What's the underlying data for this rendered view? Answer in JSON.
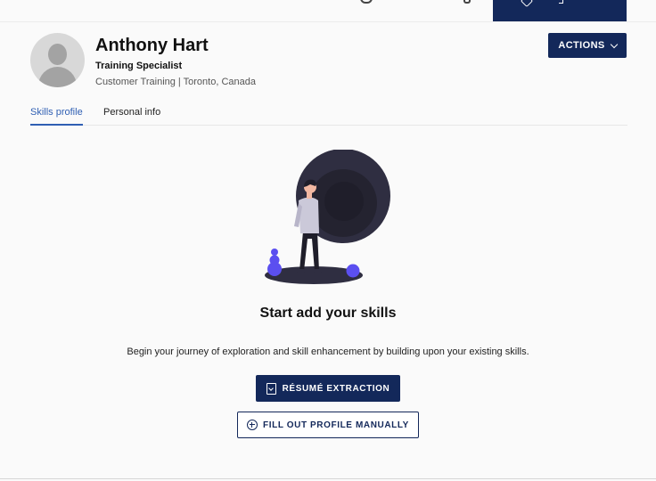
{
  "profile": {
    "name": "Anthony Hart",
    "title": "Training Specialist",
    "meta": "Customer Training | Toronto, Canada",
    "actions_label": "ACTIONS"
  },
  "tabs": [
    {
      "label": "Skills profile",
      "active": true
    },
    {
      "label": "Personal info",
      "active": false
    }
  ],
  "empty_state": {
    "heading": "Start add your skills",
    "description": "Begin your journey of exploration and skill enhancement by building upon your existing skills.",
    "primary_button": "RÉSUMÉ EXTRACTION",
    "secondary_button": "FILL OUT PROFILE MANUALLY"
  },
  "colors": {
    "brand_navy": "#13285a",
    "tab_active": "#2f5fb3",
    "accent_purple": "#5b4ff0",
    "illustration_dark": "#2f2e41"
  },
  "icons": {
    "actions": "chevron-down-icon",
    "resume": "document-download-icon",
    "manual": "plus-circle-icon",
    "avatar": "avatar-placeholder"
  }
}
